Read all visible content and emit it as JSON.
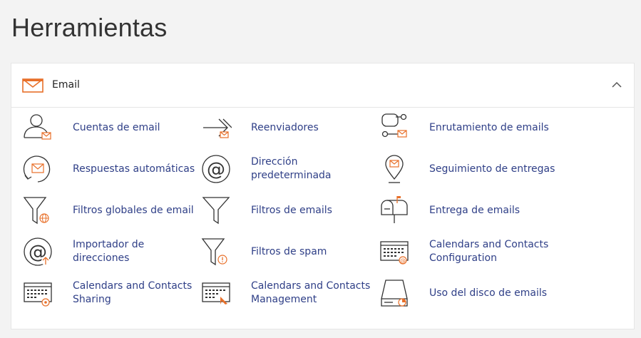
{
  "page": {
    "title": "Herramientas"
  },
  "section": {
    "title": "Email",
    "icon": "envelope-icon",
    "toggle_icon": "chevron-up-icon"
  },
  "colors": {
    "link": "#2f3f87",
    "accent": "#e8702a",
    "icon_stroke": "#333333"
  },
  "tools": [
    {
      "label": "Cuentas de email",
      "icon": "email-accounts-icon"
    },
    {
      "label": "Reenviadores",
      "icon": "forwarders-icon"
    },
    {
      "label": "Enrutamiento de emails",
      "icon": "email-routing-icon"
    },
    {
      "label": "Respuestas automáticas",
      "icon": "autoresponders-icon"
    },
    {
      "label": "Dirección predeterminada",
      "icon": "default-address-icon"
    },
    {
      "label": "Seguimiento de entregas",
      "icon": "track-delivery-icon"
    },
    {
      "label": "Filtros globales de email",
      "icon": "global-email-filters-icon"
    },
    {
      "label": "Filtros de emails",
      "icon": "email-filters-icon"
    },
    {
      "label": "Entrega de emails",
      "icon": "email-deliverability-icon"
    },
    {
      "label": "Importador de direcciones",
      "icon": "address-importer-icon"
    },
    {
      "label": "Filtros de spam",
      "icon": "spam-filters-icon"
    },
    {
      "label": "Calendars and Contacts Configuration",
      "icon": "calendars-config-icon"
    },
    {
      "label": "Calendars and Contacts Sharing",
      "icon": "calendars-sharing-icon"
    },
    {
      "label": "Calendars and Contacts Management",
      "icon": "calendars-management-icon"
    },
    {
      "label": "Uso del disco de emails",
      "icon": "email-disk-usage-icon"
    }
  ]
}
